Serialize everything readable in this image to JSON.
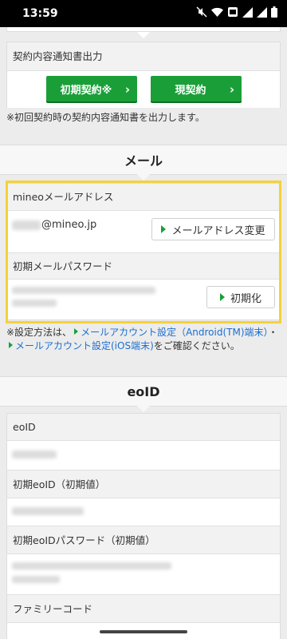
{
  "status_bar": {
    "time": "13:59"
  },
  "contract": {
    "label": "契約内容通知書出力",
    "initial_button": "初期契約※",
    "current_button": "現契約",
    "note": "※初回契約時の契約内容通知書を出力します。"
  },
  "mail": {
    "title": "メール",
    "address_label": "mineoメールアドレス",
    "address_domain": "@mineo.jp",
    "change_button": "メールアドレス変更",
    "password_label": "初期メールパスワード",
    "reset_button": "初期化",
    "note_prefix": "※設定方法は、",
    "link_android": "メールアカウント設定（Android(TM)端末）",
    "separator": "・",
    "link_ios": "メールアカウント設定(iOS端末)",
    "note_suffix": "をご確認ください。"
  },
  "eoid": {
    "title": "eoID",
    "eoid_label": "eoID",
    "initial_eoid_label": "初期eoID（初期値）",
    "initial_password_label": "初期eoIDパスワード（初期値）",
    "family_code_label": "ファミリーコード"
  },
  "colors": {
    "green": "#1a9f38",
    "link": "#1a6fd1",
    "highlight": "#f5d237"
  }
}
